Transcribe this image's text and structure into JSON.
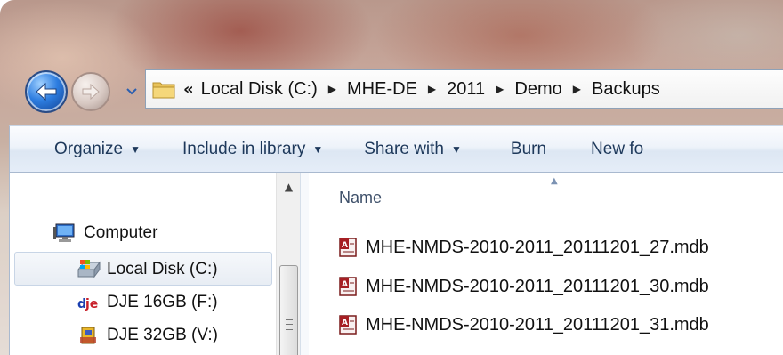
{
  "address": {
    "overflow": "«",
    "crumbs": [
      "Local Disk (C:)",
      "MHE-DE",
      "2011",
      "Demo",
      "Backups"
    ]
  },
  "commands": [
    "Organize",
    "Include in library",
    "Share with",
    "Burn",
    "New fo"
  ],
  "nav": {
    "items": [
      {
        "label": "Computer",
        "icon": "computer-icon"
      },
      {
        "label": "Local Disk (C:)",
        "icon": "local-disk-icon",
        "selected": true
      },
      {
        "label": "DJE 16GB (F:)",
        "icon": "dje-drive-icon"
      },
      {
        "label": "DJE 32GB (V:)",
        "icon": "usb-drive-icon"
      }
    ]
  },
  "filelist": {
    "column_name": "Name",
    "files": [
      "MHE-NMDS-2010-2011_20111201_27.mdb",
      "MHE-NMDS-2010-2011_20111201_30.mdb",
      "MHE-NMDS-2010-2011_20111201_31.mdb"
    ]
  },
  "colors": {
    "command_text": "#1e395b",
    "column_header": "#3d4f69",
    "back_button": "#2d7de0"
  }
}
